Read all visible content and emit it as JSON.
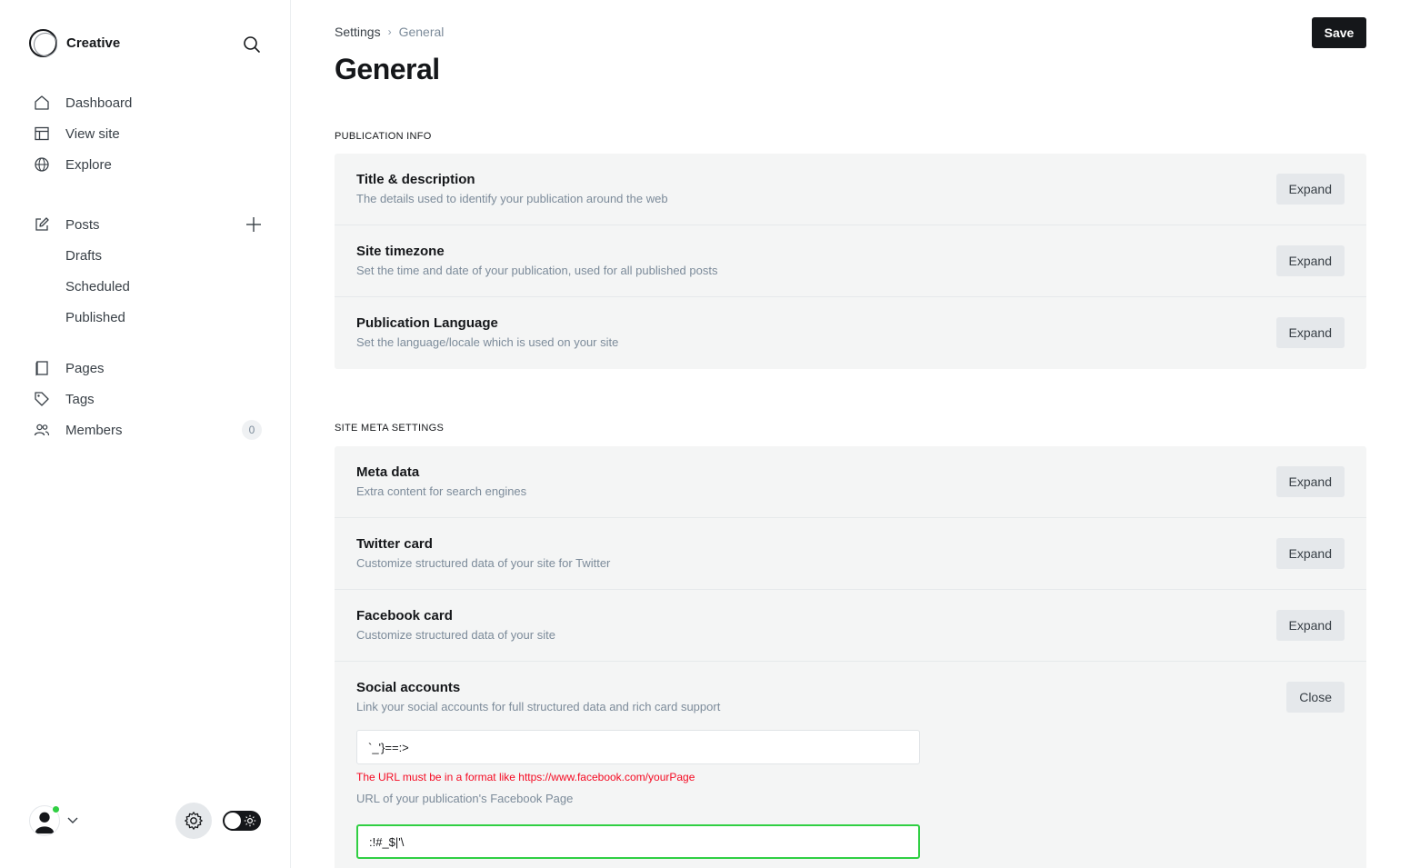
{
  "brand": {
    "name": "Creative"
  },
  "nav": {
    "primary": [
      {
        "label": "Dashboard",
        "icon": "home-icon"
      },
      {
        "label": "View site",
        "icon": "layout-icon"
      },
      {
        "label": "Explore",
        "icon": "globe-icon"
      }
    ],
    "posts": {
      "label": "Posts",
      "icon": "edit-icon"
    },
    "post_sub": [
      "Drafts",
      "Scheduled",
      "Published"
    ],
    "secondary": [
      {
        "label": "Pages",
        "icon": "page-icon"
      },
      {
        "label": "Tags",
        "icon": "tag-icon"
      },
      {
        "label": "Members",
        "icon": "members-icon",
        "badge": "0"
      }
    ]
  },
  "header": {
    "breadcrumb_parent": "Settings",
    "breadcrumb_current": "General",
    "title": "General",
    "save_label": "Save"
  },
  "sections": {
    "publication": {
      "label": "PUBLICATION INFO",
      "rows": [
        {
          "title": "Title & description",
          "desc": "The details used to identify your publication around the web",
          "button": "Expand"
        },
        {
          "title": "Site timezone",
          "desc": "Set the time and date of your publication, used for all published posts",
          "button": "Expand"
        },
        {
          "title": "Publication Language",
          "desc": "Set the language/locale which is used on your site",
          "button": "Expand"
        }
      ]
    },
    "meta": {
      "label": "SITE META SETTINGS",
      "rows": [
        {
          "title": "Meta data",
          "desc": "Extra content for search engines",
          "button": "Expand"
        },
        {
          "title": "Twitter card",
          "desc": "Customize structured data of your site for Twitter",
          "button": "Expand"
        },
        {
          "title": "Facebook card",
          "desc": "Customize structured data of your site",
          "button": "Expand"
        }
      ],
      "social": {
        "title": "Social accounts",
        "desc": "Link your social accounts for full structured data and rich card support",
        "button": "Close",
        "facebook_value": "`_'}==:>",
        "facebook_error": "The URL must be in a format like https://www.facebook.com/yourPage",
        "facebook_hint": "URL of your publication's Facebook Page",
        "twitter_value": ":!#_$|'\\"
      }
    }
  },
  "colors": {
    "accent_green": "#30cf43",
    "error_red": "#f50b23",
    "dark": "#15171a"
  }
}
